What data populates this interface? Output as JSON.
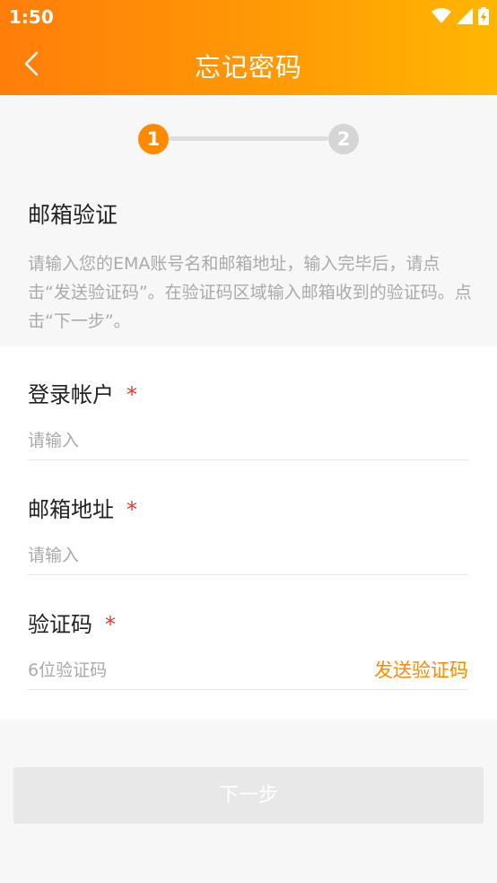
{
  "status_bar": {
    "time": "1:50",
    "icons": [
      "wifi-icon",
      "signal-icon",
      "battery-icon"
    ]
  },
  "header": {
    "title": "忘记密码",
    "back_icon": "chevron-left-icon"
  },
  "stepper": {
    "steps": [
      "1",
      "2"
    ],
    "active": 1
  },
  "section": {
    "title": "邮箱验证",
    "description": "请输入您的EMA账号名和邮箱地址，输入完毕后，请点击“发送验证码”。在验证码区域输入邮箱收到的验证码。点击“下一步”。"
  },
  "form": {
    "account": {
      "label": "登录帐户",
      "required": "*",
      "placeholder": "请输入"
    },
    "email": {
      "label": "邮箱地址",
      "required": "*",
      "placeholder": "请输入"
    },
    "code": {
      "label": "验证码",
      "required": "*",
      "placeholder": "6位验证码",
      "send_label": "发送验证码"
    }
  },
  "next_button": {
    "label": "下一步"
  },
  "colors": {
    "accent": "#ff8a00",
    "required": "#e53935",
    "disabled": "#e8e8e8"
  }
}
